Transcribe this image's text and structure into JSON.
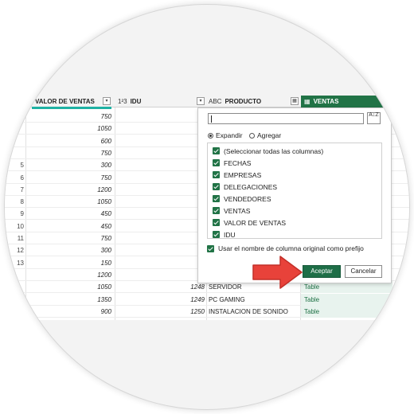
{
  "columns": {
    "valor_de_ventas": "VALOR DE VENTAS",
    "idu": "IDU",
    "producto": "PRODUCTO",
    "ventas": "VENTAS",
    "idu_type_icon": "1²3",
    "producto_type_icon": "ABC",
    "ventas_type_icon": "table-icon"
  },
  "rows": [
    {
      "rn": "",
      "valor": "750",
      "idu": "",
      "producto": "",
      "table": ""
    },
    {
      "rn": "",
      "valor": "1050",
      "idu": "",
      "producto": "",
      "table": ""
    },
    {
      "rn": "",
      "valor": "600",
      "idu": "",
      "producto": "",
      "table": ""
    },
    {
      "rn": "",
      "valor": "750",
      "idu": "",
      "producto": "",
      "table": ""
    },
    {
      "rn": "5",
      "valor": "300",
      "idu": "",
      "producto": "",
      "table": ""
    },
    {
      "rn": "6",
      "valor": "750",
      "idu": "",
      "producto": "",
      "table": ""
    },
    {
      "rn": "7",
      "valor": "1200",
      "idu": "",
      "producto": "",
      "table": ""
    },
    {
      "rn": "8",
      "valor": "1050",
      "idu": "",
      "producto": "",
      "table": ""
    },
    {
      "rn": "9",
      "valor": "450",
      "idu": "",
      "producto": "",
      "table": ""
    },
    {
      "rn": "10",
      "valor": "450",
      "idu": "",
      "producto": "",
      "table": ""
    },
    {
      "rn": "11",
      "valor": "750",
      "idu": "",
      "producto": "",
      "table": ""
    },
    {
      "rn": "12",
      "valor": "300",
      "idu": "",
      "producto": "",
      "table": ""
    },
    {
      "rn": "13",
      "valor": "150",
      "idu": "",
      "producto": "",
      "table": ""
    },
    {
      "rn": "",
      "valor": "1200",
      "idu": "",
      "producto": "",
      "table": ""
    },
    {
      "rn": "",
      "valor": "1050",
      "idu": "1248",
      "producto": "SERVIDOR",
      "table": "Table"
    },
    {
      "rn": "",
      "valor": "1350",
      "idu": "1249",
      "producto": "PC GAMING",
      "table": "Table"
    },
    {
      "rn": "",
      "valor": "900",
      "idu": "1250",
      "producto": "INSTALACION DE SONIDO",
      "table": "Table"
    }
  ],
  "popup": {
    "search_value": "",
    "sort_icon": "sort-az-icon",
    "sort_label": "A↓Z",
    "expand_label": "Expandir",
    "aggregate_label": "Agregar",
    "expand_selected": true,
    "items": [
      "(Seleccionar todas las columnas)",
      "FECHAS",
      "EMPRESAS",
      "DELEGACIONES",
      "VENDEDORES",
      "VENTAS",
      "VALOR DE VENTAS",
      "IDU"
    ],
    "prefix_label": "Usar el nombre de columna original como prefijo",
    "ok_label": "Aceptar",
    "cancel_label": "Cancelar"
  },
  "colors": {
    "accent_green": "#217346",
    "teal_underline": "#1fb1a3",
    "arrow_red": "#e8423a"
  }
}
